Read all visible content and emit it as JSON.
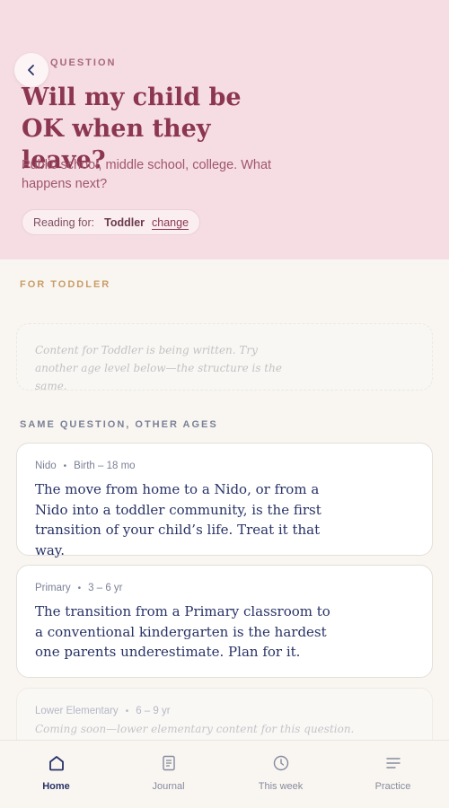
{
  "header": {
    "eyebrow": "QUESTION",
    "title": "Will my child be OK when they leave?",
    "subtitle": "Public school, middle school, college. What happens next?",
    "back_icon": "chevron-left-icon"
  },
  "reading_for": {
    "label": "Reading for:",
    "value": "Toddler",
    "change_label": "change"
  },
  "current_section": {
    "label": "FOR TODDLER",
    "placeholder": "Content for Toddler is being written. Try another age level below—the structure is the same."
  },
  "other_ages": {
    "label": "SAME QUESTION, OTHER AGES",
    "cards": [
      {
        "level": "Nido",
        "range": "Birth – 18 mo",
        "text": "The move from home to a Nido, or from a Nido into a toddler community, is the first transition of your child’s life. Treat it that way."
      },
      {
        "level": "Primary",
        "range": "3 – 6 yr",
        "text": "The transition from a Primary classroom to a conventional kindergarten is the hardest one parents underestimate. Plan for it."
      },
      {
        "level": "Lower Elementary",
        "range": "6 – 9 yr",
        "text": "Coming soon—lower elementary content for this question."
      }
    ]
  },
  "tabbar": {
    "tabs": [
      {
        "label": "Home",
        "icon": "home-icon",
        "active": true
      },
      {
        "label": "Journal",
        "icon": "journal-icon",
        "active": false
      },
      {
        "label": "This week",
        "icon": "clock-icon",
        "active": false
      },
      {
        "label": "Practice",
        "icon": "list-icon",
        "active": false
      }
    ]
  },
  "colors": {
    "hero_bg": "#f5dde3",
    "title": "#8c3651",
    "ink": "#283266",
    "accent_gold": "#c99d66"
  }
}
